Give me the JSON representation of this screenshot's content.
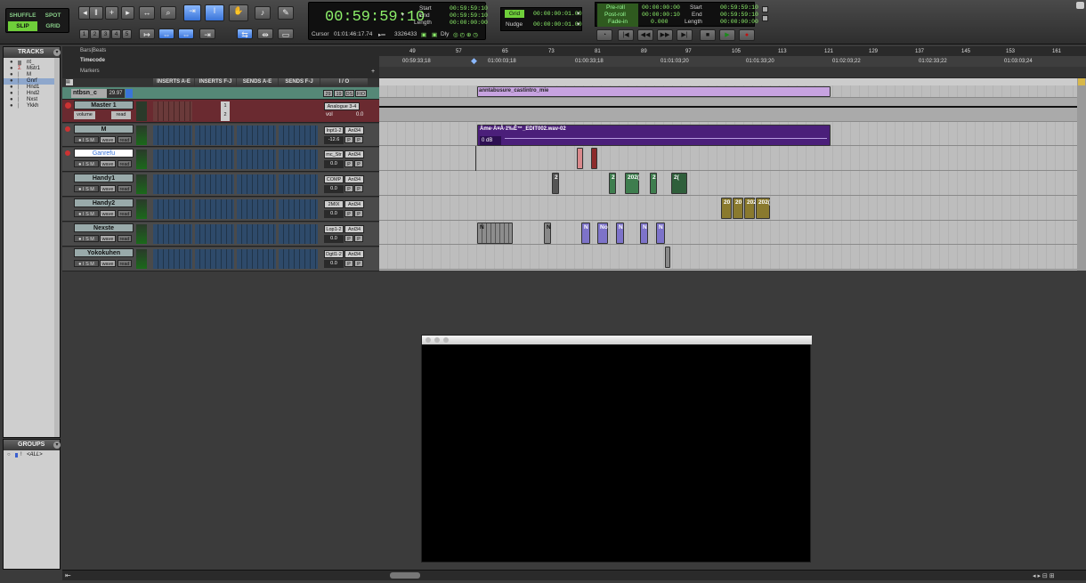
{
  "toolbar": {
    "modes": {
      "shuffle": "SHUFFLE",
      "spot": "SPOT",
      "slip": "SLIP",
      "grid": "GRID"
    },
    "zoom_presets": [
      "1",
      "2",
      "3",
      "4",
      "5"
    ]
  },
  "counter": {
    "main": "00:59:59:10",
    "start_label": "Start",
    "end_label": "End",
    "length_label": "Length",
    "start": "00:59:59:10",
    "end": "00:59:59:10",
    "length": "00:00:00:00",
    "cursor_label": "Cursor",
    "cursor_value": "01:01:46:17.74",
    "sample_value": "3326433",
    "dly_label": "Dly"
  },
  "grid": {
    "grid_label": "Grid",
    "grid_value": "00:00:00:01.00",
    "nudge_label": "Nudge",
    "nudge_value": "00:00:00:01.00"
  },
  "preroll": {
    "preroll_label": "Pre-roll",
    "preroll_value": "00:00:00:00",
    "postroll_label": "Post-roll",
    "postroll_value": "00:00:00:10",
    "fadein_label": "Fade-in",
    "fadein_value": "0.000",
    "start_label": "Start",
    "start_value": "00:59:59:10",
    "end_label": "End",
    "end_value": "00:59:59:10",
    "length_label": "Length",
    "length_value": "00:00:00:00"
  },
  "tracks_panel": {
    "title": "TRACKS",
    "items": [
      "nt_",
      "Mstr1",
      "M",
      "Gnrf",
      "Hnd1",
      "Hnd2",
      "Nxst",
      "Ykkh"
    ]
  },
  "groups_panel": {
    "title": "GROUPS",
    "items": [
      "<ALL>"
    ]
  },
  "columns": {
    "inserts_ae": "INSERTS A-E",
    "inserts_fj": "INSERTS F-J",
    "sends_ae": "SENDS A-E",
    "sends_fj": "SENDS F-J",
    "io": "I / O"
  },
  "rulers": {
    "bars_beats": "Bars|Beats",
    "timecode": "Timecode",
    "markers": "Markers"
  },
  "bar_ticks": [
    "49",
    "57",
    "65",
    "73",
    "81",
    "89",
    "97",
    "105",
    "113",
    "121",
    "129",
    "137",
    "145",
    "153",
    "161"
  ],
  "timecode_ticks": [
    "00:59:33;18",
    "01:00:03;18",
    "01:00:33;18",
    "01:01:03;20",
    "01:01:33;20",
    "01:02:03;22",
    "01:02:33;22",
    "01:03:03;24"
  ],
  "video_track": {
    "name": "ntbsn_c",
    "fps": "29.97",
    "b1": "29",
    "b2": "19",
    "b3": "DS",
    "b4": "FIO",
    "clip": "anntabusure_castintro_mie"
  },
  "master": {
    "name": "Master 1",
    "output": "Analogue 3-4",
    "mode": "volume",
    "read": "read",
    "vol_label": "vol",
    "vol_value": "0.0"
  },
  "tracks": [
    {
      "name": "M",
      "input": "Inpt1-2",
      "output": "Anl34",
      "vol": "-12.6",
      "wave": "wave",
      "read": "read"
    },
    {
      "name": "Ganrefu",
      "input": "mc_Str",
      "output": "Anl34",
      "vol": "0.0",
      "wave": "wave",
      "read": "read"
    },
    {
      "name": "Handy1",
      "input": "COMP",
      "output": "Anl34",
      "vol": "0.0",
      "wave": "wave",
      "read": "read"
    },
    {
      "name": "Handy2",
      "input": "2MIX",
      "output": "Anl34",
      "vol": "0.0",
      "wave": "wave",
      "read": "read"
    },
    {
      "name": "Nexste",
      "input": "Lop1-2",
      "output": "Anl34",
      "vol": "0.0",
      "wave": "wave",
      "read": "read"
    },
    {
      "name": "Yokokuhen",
      "input": "Dgtl1-2",
      "output": "Anl34",
      "vol": "0.0",
      "wave": "wave",
      "read": "read"
    }
  ],
  "regions": {
    "m_clip": "Äme·Ä¤Å·ž‰Ê™_EDIT002.wav-02",
    "m_gain": "0 dB",
    "handy1": [
      "2",
      "2",
      "202(",
      "2",
      "2("
    ],
    "handy2": [
      "20",
      "20",
      "202",
      "202("
    ],
    "nexste": [
      "N",
      "N",
      "N",
      "No",
      "N",
      "N",
      "N"
    ]
  },
  "colors": {
    "accent_green": "#8df06a",
    "video_clip": "#c7a3e0",
    "m_clip": "#4b1f7a",
    "handy1_clip": "#3e7d4e",
    "handy2_clip": "#8a7a2e",
    "nexste_clip": "#7d73c9"
  }
}
